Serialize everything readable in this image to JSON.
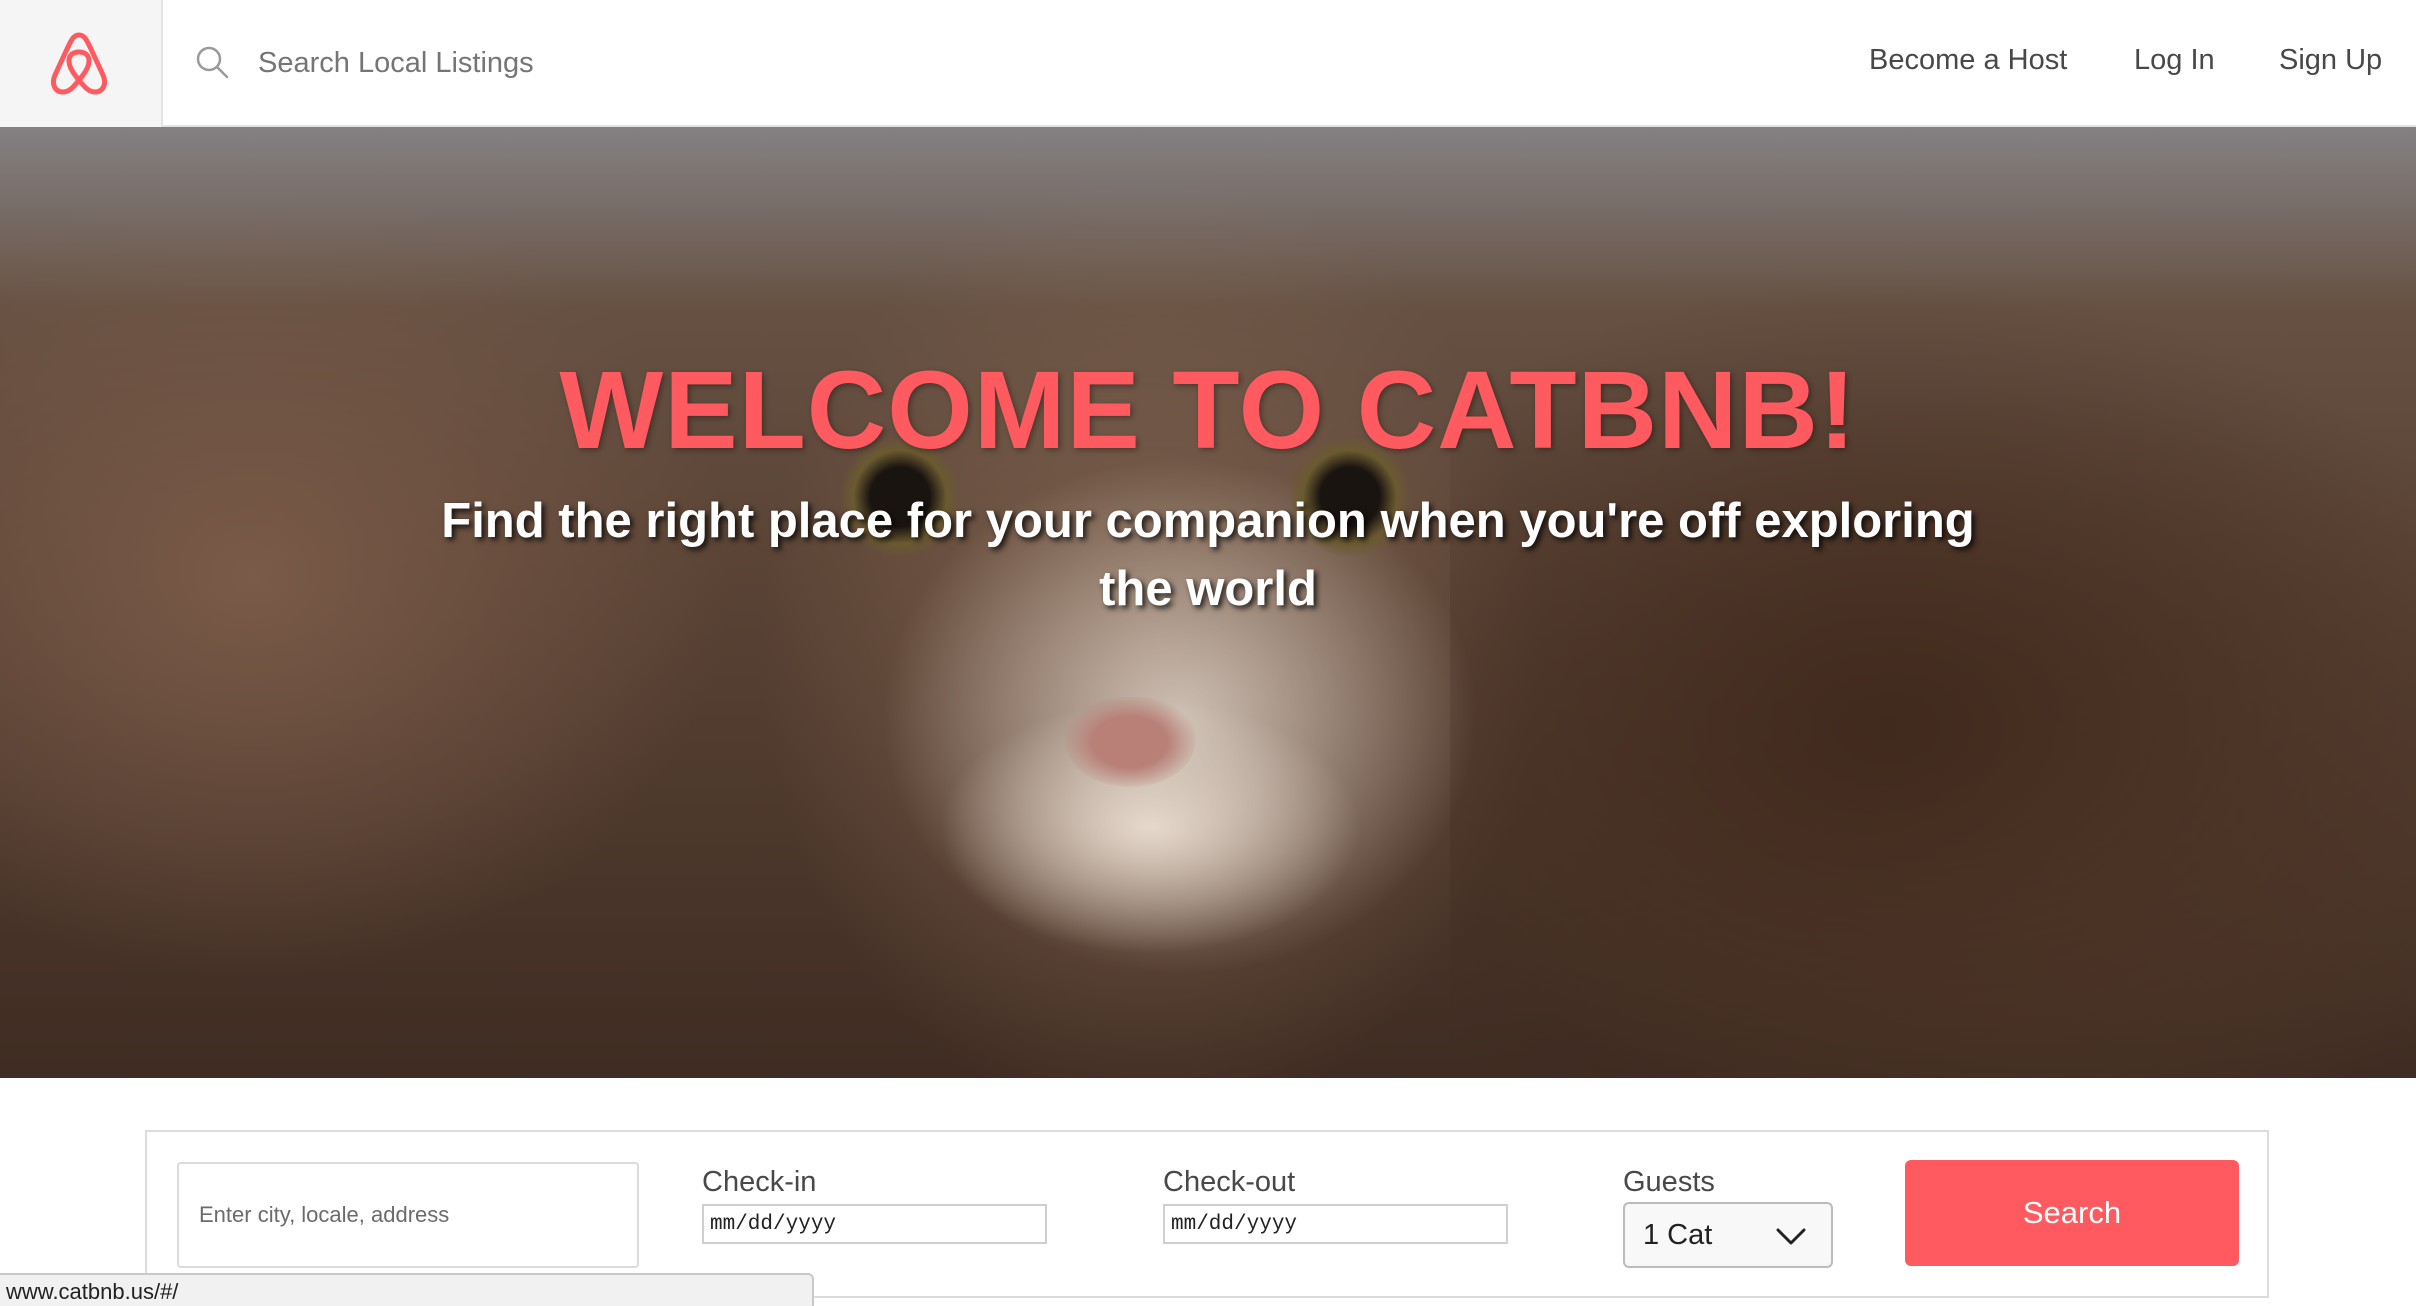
{
  "header": {
    "search": {
      "placeholder": "Search Local Listings"
    },
    "nav": {
      "become_host": "Become a Host",
      "log_in": "Log In",
      "sign_up": "Sign Up"
    }
  },
  "hero": {
    "title": "WELCOME TO CATBNB!",
    "subtitle": "Find the right place for your companion when you're off exploring the world"
  },
  "search_panel": {
    "location_placeholder": "Enter city, locale, address",
    "checkin_label": "Check-in",
    "checkin_value": "mm/dd/yyyy",
    "checkout_label": "Check-out",
    "checkout_value": "mm/dd/yyyy",
    "guests_label": "Guests",
    "guests_value": "1 Cat",
    "search_button": "Search"
  },
  "status_bar": {
    "url": "www.catbnb.us/#/"
  },
  "colors": {
    "brand": "#ff5a5f",
    "text": "#484848",
    "header_bg": "#ffffff",
    "logo_bg": "#f5f5f5"
  },
  "icons": [
    "airbnb-logo-icon",
    "search-icon",
    "chevron-down-icon"
  ]
}
